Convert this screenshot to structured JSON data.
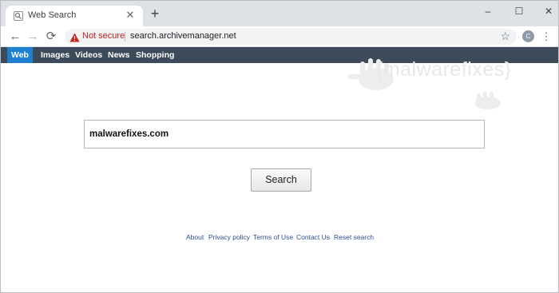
{
  "browser": {
    "tab": {
      "title": "Web Search",
      "favicon": "search-icon",
      "close": "✕"
    },
    "newtab_label": "+",
    "window_controls": {
      "minimize": "–",
      "maximize": "☐",
      "close": "✕"
    },
    "nav": {
      "back": "←",
      "forward": "→",
      "reload": "⟳"
    },
    "address": {
      "security_label": "Not secure",
      "url": "search.archivemanager.net"
    },
    "star": "☆",
    "profile_initial": "C",
    "menu": "⋮"
  },
  "site": {
    "tabs": [
      {
        "label": "Web",
        "active": true
      },
      {
        "label": "Images",
        "active": false
      },
      {
        "label": "Videos",
        "active": false
      },
      {
        "label": "News",
        "active": false
      },
      {
        "label": "Shopping",
        "active": false
      }
    ],
    "watermark": "{malwarefixes}",
    "search": {
      "value": "malwarefixes.com",
      "button": "Search"
    },
    "footer": [
      "About",
      "Privacy policy",
      "Terms of Use",
      "Contact Us",
      "Reset search"
    ]
  },
  "colors": {
    "nav_strip": "#3c4a59",
    "active_tab": "#1e7fd0",
    "not_secure": "#c5221f",
    "footer_link": "#2c4f8e"
  }
}
